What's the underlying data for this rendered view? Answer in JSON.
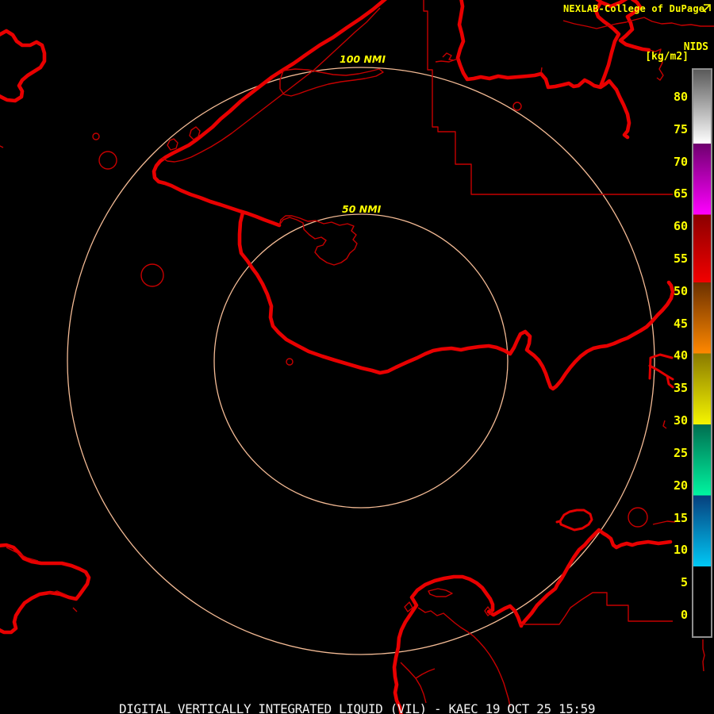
{
  "header": {
    "brand": "NEXLAB-College of DuPage",
    "link_icon": "open-in-new-icon"
  },
  "colorbar": {
    "product_label": "NIDS",
    "units_label": "[kg/m2]",
    "ticks": [
      80,
      75,
      70,
      65,
      60,
      55,
      50,
      45,
      40,
      35,
      30,
      25,
      20,
      15,
      10,
      5,
      0
    ],
    "value_top": 84.4,
    "value_bottom": -3.3,
    "segments": [
      {
        "from": 84.4,
        "to": 73.0,
        "color_top": "#5a5a5a",
        "color_bottom": "#ffffff"
      },
      {
        "from": 73.0,
        "to": 62.0,
        "color_top": "#6e006e",
        "color_bottom": "#ff00ff"
      },
      {
        "from": 62.0,
        "to": 51.5,
        "color_top": "#8b0000",
        "color_bottom": "#f20000"
      },
      {
        "from": 51.5,
        "to": 40.5,
        "color_top": "#6b3000",
        "color_bottom": "#ff8800"
      },
      {
        "from": 40.5,
        "to": 29.5,
        "color_top": "#8a7a00",
        "color_bottom": "#f5f500"
      },
      {
        "from": 29.5,
        "to": 18.5,
        "color_top": "#006e50",
        "color_bottom": "#00f5a0"
      },
      {
        "from": 18.5,
        "to": 7.5,
        "color_top": "#073f7d",
        "color_bottom": "#00c8f5"
      },
      {
        "from": 7.5,
        "to": -3.3,
        "color_top": "#000000",
        "color_bottom": "#000000"
      }
    ]
  },
  "rings": {
    "outer_label": "100 NMI",
    "inner_label": "50 NMI",
    "outer_radius_nmi": 100,
    "inner_radius_nmi": 50
  },
  "footer": {
    "title": "DIGITAL VERTICALLY INTEGRATED LIQUID (VIL) - KAEC 19 OCT 25 15:59",
    "product": "DIGITAL VERTICALLY INTEGRATED LIQUID (VIL)",
    "station": "KAEC",
    "datetime": "19 OCT 25 15:59"
  },
  "colors": {
    "background": "#000000",
    "map_outline": "#e80000",
    "range_ring": "#f4bb95",
    "label_yellow": "#ffff00",
    "footer_text": "#f2f2f2"
  }
}
